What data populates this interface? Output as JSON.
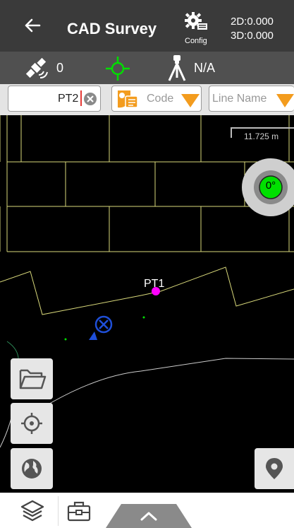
{
  "header": {
    "title": "CAD Survey",
    "config_label": "Config",
    "coord_2d": "2D:0.000",
    "coord_3d": "3D:0.000"
  },
  "status": {
    "satellite_count": "0",
    "rtk_status": "N/A"
  },
  "inputs": {
    "point_name": "PT2",
    "code_placeholder": "Code",
    "line_placeholder": "Line Name"
  },
  "map": {
    "scale": "11.725 m",
    "compass": "0°",
    "points": [
      {
        "label": "PT1"
      }
    ]
  },
  "colors": {
    "header_bg": "#3a3a3a",
    "status_bg": "#505050",
    "accent_orange": "#f39c1e",
    "gps_green": "#00dd00",
    "point_magenta": "#ff00ff",
    "grid_yellow": "#d8d87a"
  },
  "icons": [
    "back-arrow-icon",
    "gear-icon",
    "satellite-icon",
    "crosshair-icon",
    "tripod-icon",
    "clear-icon",
    "code-icon",
    "dropdown-arrow-icon",
    "folder-icon",
    "locate-icon",
    "globe-icon",
    "map-pin-icon",
    "layers-icon",
    "toolbox-icon",
    "chevron-up-icon"
  ]
}
